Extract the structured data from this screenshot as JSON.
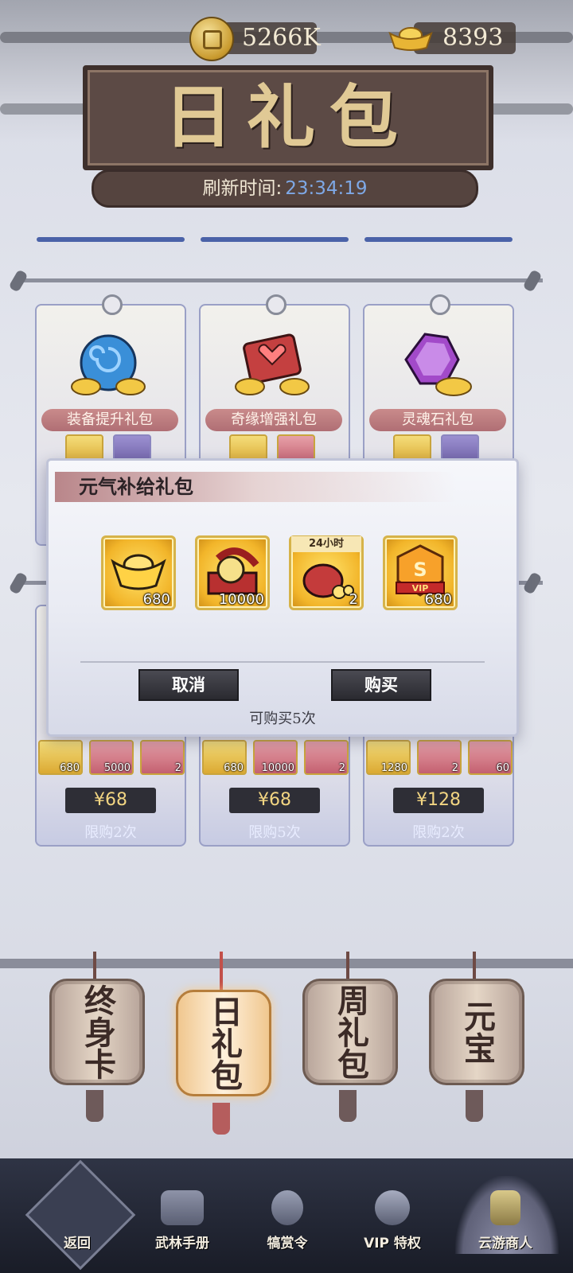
{
  "currency": {
    "coins": "5266K",
    "ingots": "8393"
  },
  "title": "日礼包",
  "refresh": {
    "label": "刷新时间:",
    "time": "23:34:19"
  },
  "cards_top": [
    {
      "name": "装备提升礼包"
    },
    {
      "name": "奇缘增强礼包"
    },
    {
      "name": "灵魂石礼包"
    }
  ],
  "cards_bottom": [
    {
      "items": [
        "680",
        "5000",
        "2"
      ],
      "price": "¥68",
      "limit": "限购2次"
    },
    {
      "items": [
        "680",
        "10000",
        "2"
      ],
      "price": "¥68",
      "limit": "限购5次"
    },
    {
      "items": [
        "1280",
        "2",
        "60"
      ],
      "price": "¥128",
      "limit": "限购2次"
    }
  ],
  "modal": {
    "title": "元气补给礼包",
    "rewards": [
      {
        "icon": "gold-ingot-icon",
        "count": "680"
      },
      {
        "icon": "treasure-ring-icon",
        "count": "10000"
      },
      {
        "icon": "lucky-bag-icon",
        "count": "2",
        "tag": "24小时"
      },
      {
        "icon": "vip-badge-icon",
        "count": "680"
      }
    ],
    "cancel": "取消",
    "buy": "购买",
    "note": "可购买5次"
  },
  "lanterns": [
    "终身卡",
    "日礼包",
    "周礼包",
    "元宝"
  ],
  "nav": [
    "返回",
    "武林手册",
    "犒赏令",
    "VIP 特权",
    "云游商人"
  ]
}
